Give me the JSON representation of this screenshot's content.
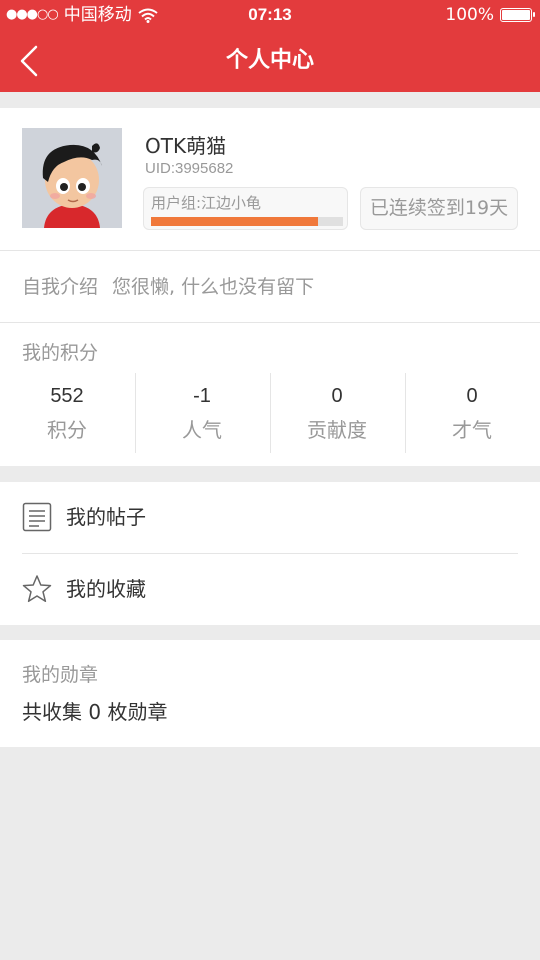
{
  "status_bar": {
    "signal": "●●●○○",
    "carrier": "中国移动",
    "time": "07:13",
    "battery": "100%"
  },
  "nav": {
    "title": "个人中心",
    "back_icon": "chevron-left-icon"
  },
  "profile": {
    "username": "OTK萌猫",
    "uid": "UID:3995682",
    "group": "用户组:江边小龟",
    "level_progress": 0.87,
    "signin": "已连续签到19天"
  },
  "intro": {
    "label": "自我介绍",
    "text": "您很懒, 什么也没有留下"
  },
  "points": {
    "title": "我的积分",
    "stats": [
      {
        "value": "552",
        "label": "积分"
      },
      {
        "value": "-1",
        "label": "人气"
      },
      {
        "value": "0",
        "label": "贡献度"
      },
      {
        "value": "0",
        "label": "才气"
      }
    ]
  },
  "menu": {
    "items": [
      {
        "label": "我的帖子",
        "icon": "document-icon"
      },
      {
        "label": "我的收藏",
        "icon": "star-icon"
      }
    ]
  },
  "medals": {
    "title": "我的勋章",
    "count_text": "共收集 0 枚勋章"
  },
  "colors": {
    "brand": "#e33b3d",
    "progress": "#f0783a",
    "background": "#ebebeb"
  }
}
